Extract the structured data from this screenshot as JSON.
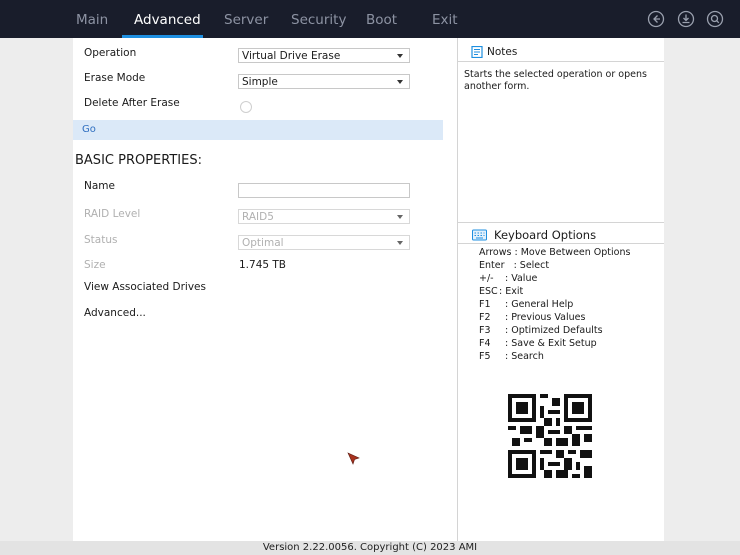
{
  "top_nav": {
    "tabs": [
      {
        "label": "Main"
      },
      {
        "label": "Advanced"
      },
      {
        "label": "Server"
      },
      {
        "label": "Security"
      },
      {
        "label": "Boot"
      },
      {
        "label": "Exit"
      }
    ],
    "active_tab": "Advanced",
    "icons": [
      "back-icon",
      "download-icon",
      "search-icon"
    ]
  },
  "form": {
    "operation": {
      "label": "Operation",
      "value": "Virtual Drive Erase"
    },
    "erase_mode": {
      "label": "Erase Mode",
      "value": "Simple"
    },
    "delete_after_erase": {
      "label": "Delete After Erase",
      "checked": false
    },
    "go_label": "Go",
    "section_title": "BASIC PROPERTIES:",
    "name": {
      "label": "Name",
      "value": ""
    },
    "raid_level": {
      "label": "RAID Level",
      "value": "RAID5"
    },
    "status": {
      "label": "Status",
      "value": "Optimal"
    },
    "size": {
      "label": "Size",
      "value": "1.745 TB"
    },
    "view_associated_drives": "View Associated Drives",
    "advanced": "Advanced..."
  },
  "notes": {
    "title": "Notes",
    "text": "Starts the selected operation or opens another form."
  },
  "keyboard": {
    "title": "Keyboard Options",
    "rows": [
      {
        "key": "Arrows",
        "desc": ": Move Between Options"
      },
      {
        "key": "Enter",
        "desc": ": Select"
      },
      {
        "key": "+/-",
        "desc": ": Value"
      },
      {
        "key": "ESC",
        "desc": ": Exit"
      },
      {
        "key": "F1",
        "desc": ": General Help"
      },
      {
        "key": "F2",
        "desc": ": Previous Values"
      },
      {
        "key": "F3",
        "desc": ": Optimized Defaults"
      },
      {
        "key": "F4",
        "desc": ": Save & Exit Setup"
      },
      {
        "key": "F5",
        "desc": ": Search"
      }
    ]
  },
  "footer": {
    "text": "Version 2.22.0056. Copyright (C) 2023 AMI"
  },
  "colors": {
    "accent": "#1e8fe0",
    "topbar": "#191d2b",
    "highlight_row": "#dbe9f8"
  }
}
